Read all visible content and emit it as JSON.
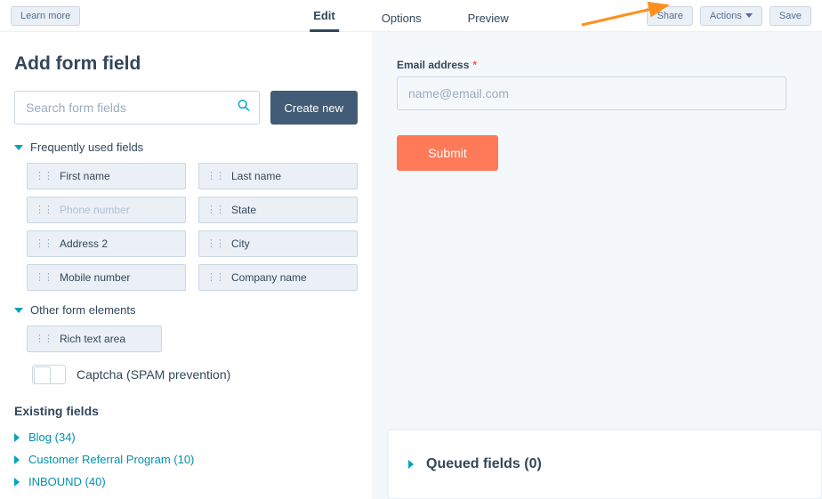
{
  "topbar": {
    "learn_more": "Learn more",
    "tabs": {
      "edit": "Edit",
      "options": "Options",
      "preview": "Preview"
    },
    "share": "Share",
    "actions": "Actions",
    "save": "Save"
  },
  "left": {
    "title": "Add form field",
    "search_placeholder": "Search form fields",
    "create_new": "Create new",
    "freq_title": "Frequently used fields",
    "fields": {
      "first_name": "First name",
      "last_name": "Last name",
      "phone_number": "Phone number",
      "state": "State",
      "address2": "Address 2",
      "city": "City",
      "mobile_number": "Mobile number",
      "company_name": "Company name"
    },
    "other_title": "Other form elements",
    "rich_text": "Rich text area",
    "captcha": "Captcha (SPAM prevention)",
    "existing_title": "Existing fields",
    "existing": {
      "blog": "Blog (34)",
      "crp": "Customer Referral Program (10)",
      "inbound": "INBOUND (40)"
    }
  },
  "form": {
    "email_label": "Email address",
    "email_placeholder": "name@email.com",
    "submit": "Submit"
  },
  "queued": {
    "title": "Queued fields (0)"
  }
}
